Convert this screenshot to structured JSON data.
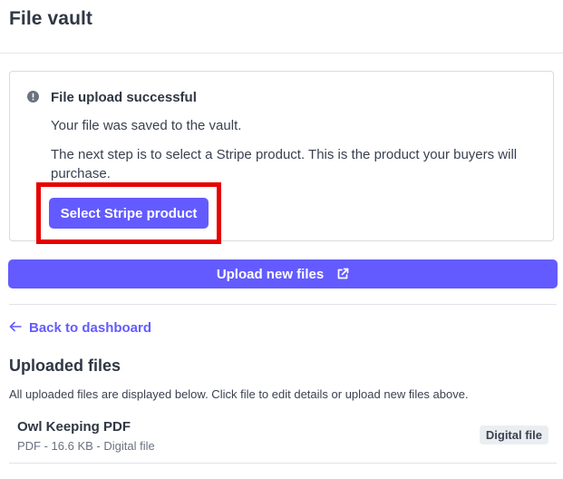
{
  "page": {
    "title": "File vault"
  },
  "notice": {
    "title": "File upload successful",
    "line1": "Your file was saved to the vault.",
    "line2": "The next step is to select a Stripe product. This is the product your buyers will purchase.",
    "button_label": "Select Stripe product",
    "icon": "alert-circle-icon"
  },
  "upload": {
    "label": "Upload new files",
    "icon": "external-link-icon"
  },
  "back": {
    "label": "Back to dashboard",
    "icon": "arrow-left-icon"
  },
  "files_section": {
    "title": "Uploaded files",
    "description": "All uploaded files are displayed below. Click file to edit details or upload new files above.",
    "files": [
      {
        "name": "Owl Keeping PDF",
        "meta": "PDF - 16.6 KB - Digital file",
        "badge": "Digital file"
      }
    ]
  },
  "colors": {
    "accent": "#635bff",
    "highlight": "#e60000",
    "text": "#2f3744",
    "muted": "#6b7280"
  }
}
